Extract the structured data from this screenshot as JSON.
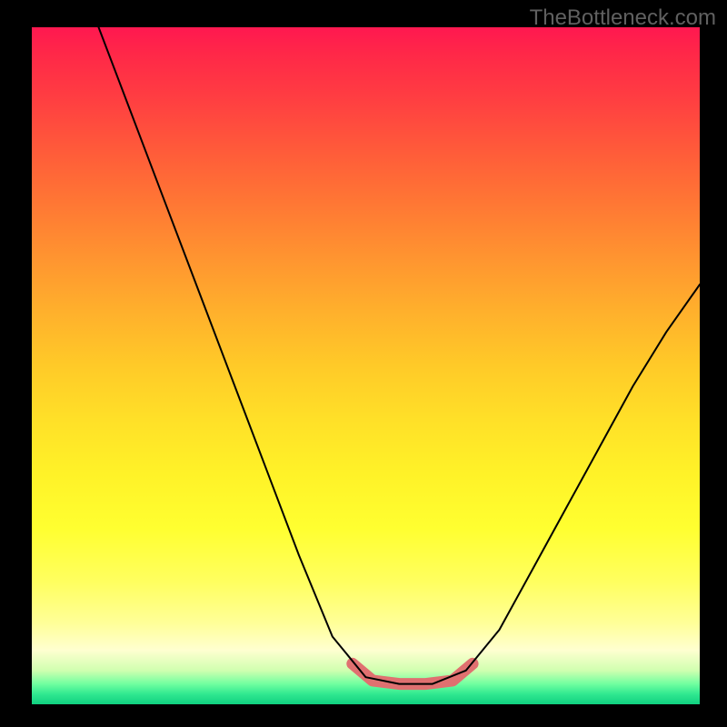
{
  "watermark": "TheBottleneck.com",
  "chart_data": {
    "type": "line",
    "title": "",
    "xlabel": "",
    "ylabel": "",
    "x_range": [
      0,
      100
    ],
    "y_range": [
      0,
      100
    ],
    "series": [
      {
        "name": "main-curve",
        "color": "#000000",
        "stroke_width": 2,
        "points": [
          {
            "x": 10,
            "y": 100
          },
          {
            "x": 15,
            "y": 87
          },
          {
            "x": 20,
            "y": 74
          },
          {
            "x": 25,
            "y": 61
          },
          {
            "x": 30,
            "y": 48
          },
          {
            "x": 35,
            "y": 35
          },
          {
            "x": 40,
            "y": 22
          },
          {
            "x": 45,
            "y": 10
          },
          {
            "x": 50,
            "y": 4
          },
          {
            "x": 55,
            "y": 3
          },
          {
            "x": 60,
            "y": 3
          },
          {
            "x": 65,
            "y": 5
          },
          {
            "x": 70,
            "y": 11
          },
          {
            "x": 75,
            "y": 20
          },
          {
            "x": 80,
            "y": 29
          },
          {
            "x": 85,
            "y": 38
          },
          {
            "x": 90,
            "y": 47
          },
          {
            "x": 95,
            "y": 55
          },
          {
            "x": 100,
            "y": 62
          }
        ]
      },
      {
        "name": "highlight-segment",
        "color": "#e07070",
        "stroke_width": 13,
        "points": [
          {
            "x": 48,
            "y": 6
          },
          {
            "x": 51,
            "y": 3.5
          },
          {
            "x": 55,
            "y": 3
          },
          {
            "x": 59,
            "y": 3
          },
          {
            "x": 63,
            "y": 3.5
          },
          {
            "x": 66,
            "y": 6
          }
        ]
      }
    ],
    "gradient": {
      "direction": "vertical",
      "stops": [
        {
          "pos": 0,
          "color": "#ff1850"
        },
        {
          "pos": 50,
          "color": "#ffca28"
        },
        {
          "pos": 88,
          "color": "#ffff98"
        },
        {
          "pos": 100,
          "color": "#10d080"
        }
      ]
    }
  }
}
